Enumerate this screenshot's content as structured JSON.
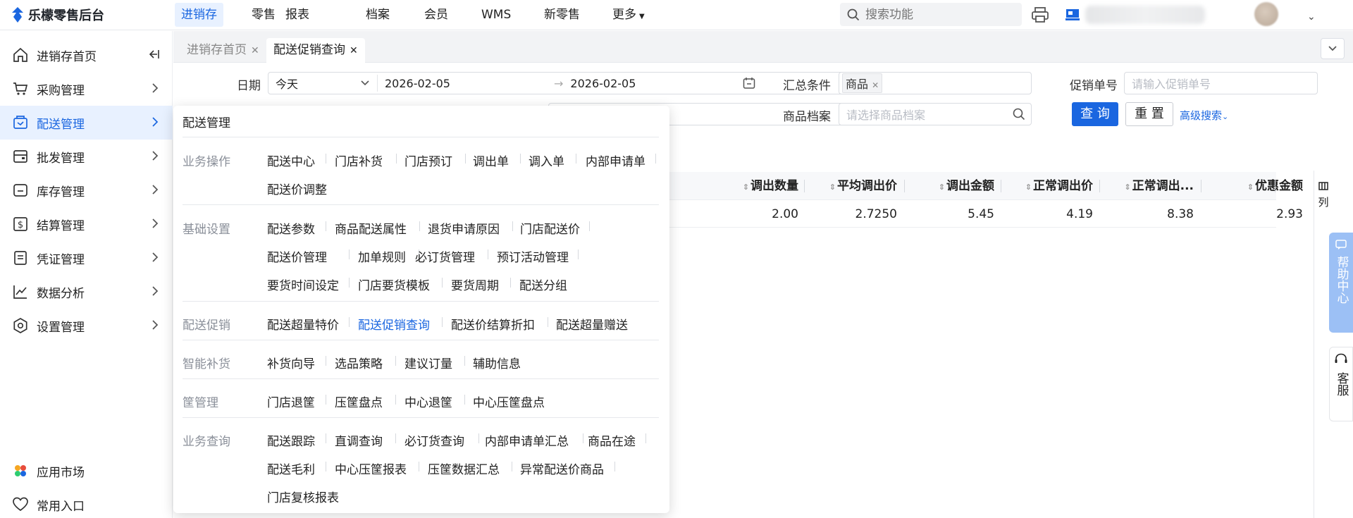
{
  "brand": {
    "name": "乐檬零售后台"
  },
  "nav": [
    {
      "label": "进销存",
      "active": true
    },
    {
      "label": "零售"
    },
    {
      "label": "报表"
    },
    {
      "label": "档案"
    },
    {
      "label": "会员"
    },
    {
      "label": "WMS"
    },
    {
      "label": "新零售"
    },
    {
      "label": "更多"
    }
  ],
  "search": {
    "placeholder": "搜索功能"
  },
  "sidebar": {
    "items": [
      {
        "label": "进销存首页",
        "icon": "home-icon"
      },
      {
        "label": "采购管理",
        "icon": "cart-icon"
      },
      {
        "label": "配送管理",
        "icon": "delivery-icon",
        "active": true
      },
      {
        "label": "批发管理",
        "icon": "wholesale-icon"
      },
      {
        "label": "库存管理",
        "icon": "inventory-icon"
      },
      {
        "label": "结算管理",
        "icon": "settlement-icon"
      },
      {
        "label": "凭证管理",
        "icon": "voucher-icon"
      },
      {
        "label": "数据分析",
        "icon": "chart-icon"
      },
      {
        "label": "设置管理",
        "icon": "settings-icon"
      }
    ],
    "bottom": [
      {
        "label": "应用市场",
        "icon": "app-market-icon"
      },
      {
        "label": "常用入口",
        "icon": "heart-icon"
      }
    ]
  },
  "tabs": [
    {
      "label": "进销存首页",
      "active": false
    },
    {
      "label": "配送促销查询",
      "active": true
    }
  ],
  "filters": {
    "date_label": "日期",
    "date_preset": "今天",
    "date_start": "2026-02-05",
    "date_end": "2026-02-05",
    "summary_label": "汇总条件",
    "summary_tag": "商品",
    "promo_no_label": "促销单号",
    "promo_no_placeholder": "请输入促销单号",
    "product_label": "商品档案",
    "product_placeholder": "请选择商品档案",
    "query_btn": "查 询",
    "reset_btn": "重 置",
    "advanced": "高级搜索"
  },
  "table": {
    "columns": [
      "调出数量",
      "平均调出价",
      "调出金额",
      "正常调出价",
      "正常调出...",
      "优惠金额"
    ],
    "rows": [
      [
        "2.00",
        "2.7250",
        "5.45",
        "4.19",
        "8.38",
        "2.93"
      ]
    ],
    "col_setting": "列"
  },
  "help": {
    "label": "帮助中心",
    "service": "客服"
  },
  "popup": {
    "title": "配送管理",
    "sections": [
      {
        "label": "业务操作",
        "links": [
          "配送中心",
          "门店补货",
          "门店预订",
          "调出单",
          "调入单",
          "内部申请单",
          "配送价调整"
        ]
      },
      {
        "label": "基础设置",
        "links": [
          "配送参数",
          "商品配送属性",
          "退货申请原因",
          "门店配送价",
          "配送价管理",
          "加单规则",
          "必订货管理",
          "预订活动管理",
          "要货时间设定",
          "门店要货模板",
          "要货周期",
          "配送分组"
        ]
      },
      {
        "label": "配送促销",
        "links": [
          "配送超量特价",
          "配送促销查询",
          "配送价结算折扣",
          "配送超量赠送"
        ],
        "active": "配送促销查询"
      },
      {
        "label": "智能补货",
        "links": [
          "补货向导",
          "选品策略",
          "建议订量",
          "辅助信息"
        ]
      },
      {
        "label": "筐管理",
        "links": [
          "门店退筐",
          "压筐盘点",
          "中心退筐",
          "中心压筐盘点"
        ]
      },
      {
        "label": "业务查询",
        "links": [
          "配送跟踪",
          "直调查询",
          "必订货查询",
          "内部申请单汇总",
          "商品在途",
          "配送毛利",
          "中心压筐报表",
          "压筐数据汇总",
          "异常配送价商品",
          "门店复核报表"
        ]
      }
    ]
  },
  "colors": {
    "accent": "#1a66e0",
    "active_bg": "#e8f1ff",
    "help_bg": "#9cc0f5"
  }
}
